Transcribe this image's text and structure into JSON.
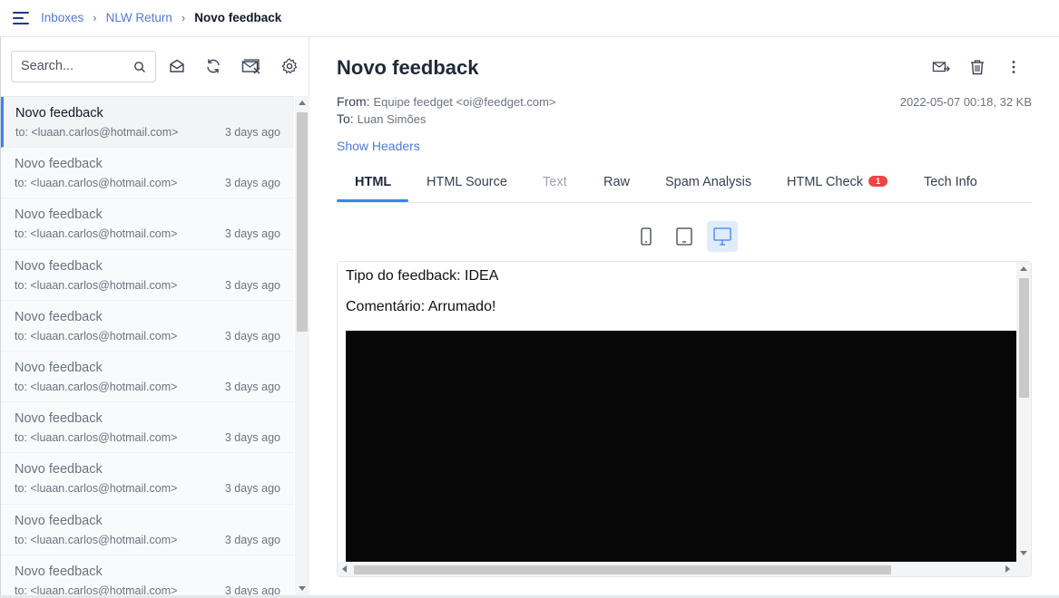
{
  "breadcrumb": {
    "inboxes": "Inboxes",
    "inbox": "NLW Return",
    "current": "Novo feedback"
  },
  "sidebar": {
    "search_placeholder": "Search...",
    "messages": [
      {
        "subject": "Novo feedback",
        "to": "to: <luaan.carlos@hotmail.com>",
        "time": "3 days ago",
        "active": true
      },
      {
        "subject": "Novo feedback",
        "to": "to: <luaan.carlos@hotmail.com>",
        "time": "3 days ago"
      },
      {
        "subject": "Novo feedback",
        "to": "to: <luaan.carlos@hotmail.com>",
        "time": "3 days ago"
      },
      {
        "subject": "Novo feedback",
        "to": "to: <luaan.carlos@hotmail.com>",
        "time": "3 days ago"
      },
      {
        "subject": "Novo feedback",
        "to": "to: <luaan.carlos@hotmail.com>",
        "time": "3 days ago"
      },
      {
        "subject": "Novo feedback",
        "to": "to: <luaan.carlos@hotmail.com>",
        "time": "3 days ago"
      },
      {
        "subject": "Novo feedback",
        "to": "to: <luaan.carlos@hotmail.com>",
        "time": "3 days ago"
      },
      {
        "subject": "Novo feedback",
        "to": "to: <luaan.carlos@hotmail.com>",
        "time": "3 days ago"
      },
      {
        "subject": "Novo feedback",
        "to": "to: <luaan.carlos@hotmail.com>",
        "time": "3 days ago"
      },
      {
        "subject": "Novo feedback",
        "to": "to: <luaan.carlos@hotmail.com>",
        "time": "3 days ago"
      }
    ]
  },
  "message": {
    "title": "Novo feedback",
    "from_label": "From:",
    "from": "Equipe feedget <oi@feedget.com>",
    "to_label": "To:",
    "to": "Luan Simões",
    "date_size": "2022-05-07 00:18, 32 KB",
    "show_headers": "Show Headers"
  },
  "tabs": [
    {
      "label": "HTML",
      "state": "active"
    },
    {
      "label": "HTML Source",
      "state": "normal"
    },
    {
      "label": "Text",
      "state": "disabled"
    },
    {
      "label": "Raw",
      "state": "normal"
    },
    {
      "label": "Spam Analysis",
      "state": "normal"
    },
    {
      "label": "HTML Check",
      "state": "normal",
      "badge": "1"
    },
    {
      "label": "Tech Info",
      "state": "normal"
    }
  ],
  "preview": {
    "line1": "Tipo do feedback: IDEA",
    "line2": "Comentário: Arrumado!"
  },
  "colors": {
    "accent": "#3b82f6",
    "link": "#4f7bd6",
    "badge": "#ef4444"
  },
  "icons": [
    "menu-icon",
    "search-icon",
    "mark-read-icon",
    "refresh-icon",
    "clear-inbox-icon",
    "settings-icon",
    "forward-icon",
    "trash-icon",
    "more-icon",
    "phone-icon",
    "tablet-icon",
    "desktop-icon"
  ]
}
